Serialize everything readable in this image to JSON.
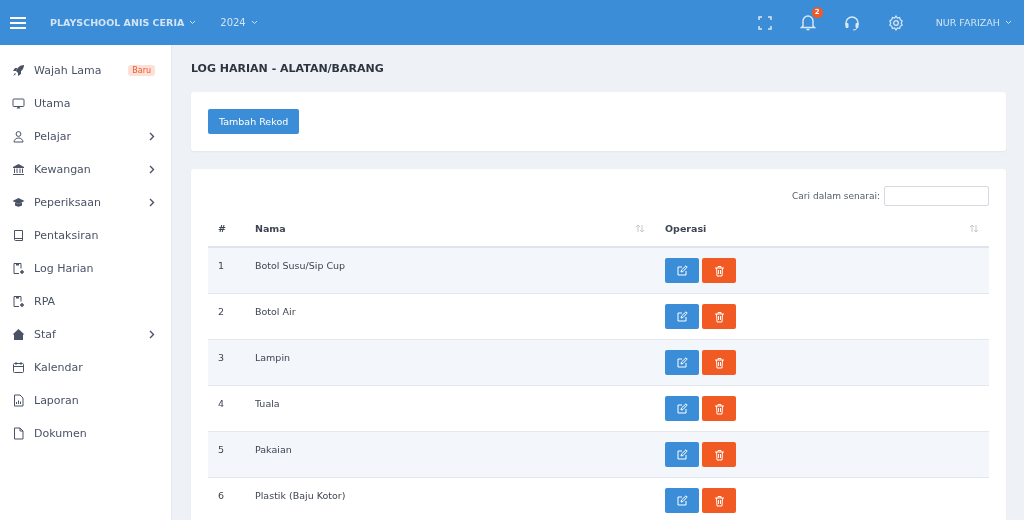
{
  "topbar": {
    "school": "PLAYSCHOOL ANIS CERIA",
    "year": "2024",
    "notification_count": "2",
    "user": "NUR FARIZAH"
  },
  "sidebar": {
    "items": [
      {
        "label": "Wajah Lama",
        "badge": "Baru",
        "expandable": false
      },
      {
        "label": "Utama",
        "expandable": false
      },
      {
        "label": "Pelajar",
        "expandable": true
      },
      {
        "label": "Kewangan",
        "expandable": true
      },
      {
        "label": "Peperiksaan",
        "expandable": true
      },
      {
        "label": "Pentaksiran",
        "expandable": false
      },
      {
        "label": "Log Harian",
        "expandable": false
      },
      {
        "label": "RPA",
        "expandable": false
      },
      {
        "label": "Staf",
        "expandable": true
      },
      {
        "label": "Kalendar",
        "expandable": false
      },
      {
        "label": "Laporan",
        "expandable": false
      },
      {
        "label": "Dokumen",
        "expandable": false
      }
    ]
  },
  "page_title": "LOG HARIAN - ALATAN/BARANG",
  "add_button": "Tambah Rekod",
  "search": {
    "label": "Cari dalam senarai:"
  },
  "table": {
    "columns": [
      "#",
      "Nama",
      "Operasi"
    ],
    "rows": [
      {
        "no": "1",
        "name": "Botol Susu/Sip Cup"
      },
      {
        "no": "2",
        "name": "Botol Air"
      },
      {
        "no": "3",
        "name": "Lampin"
      },
      {
        "no": "4",
        "name": "Tuala"
      },
      {
        "no": "5",
        "name": "Pakaian"
      },
      {
        "no": "6",
        "name": "Plastik (Baju Kotor)"
      }
    ]
  }
}
